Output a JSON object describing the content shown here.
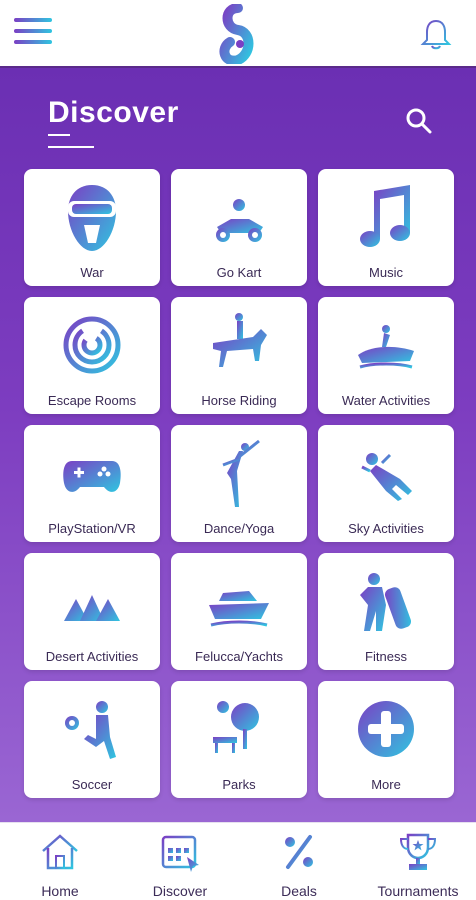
{
  "header": {
    "menu_icon": "hamburger-menu-icon",
    "logo": "app-logo",
    "notification_icon": "bell-icon"
  },
  "page": {
    "title": "Discover",
    "search_icon": "search-icon"
  },
  "categories": [
    {
      "label": "War",
      "icon": "paintball-mask-icon"
    },
    {
      "label": "Go Kart",
      "icon": "go-kart-icon"
    },
    {
      "label": "Music",
      "icon": "music-note-icon"
    },
    {
      "label": "Escape Rooms",
      "icon": "maze-icon"
    },
    {
      "label": "Horse Riding",
      "icon": "horse-rider-icon"
    },
    {
      "label": "Water Activities",
      "icon": "jet-ski-icon"
    },
    {
      "label": "PlayStation/VR",
      "icon": "gamepad-icon"
    },
    {
      "label": "Dance/Yoga",
      "icon": "dancer-icon"
    },
    {
      "label": "Sky Activities",
      "icon": "skydiver-icon"
    },
    {
      "label": "Desert Activities",
      "icon": "tents-icon"
    },
    {
      "label": "Felucca/Yachts",
      "icon": "yacht-icon"
    },
    {
      "label": "Fitness",
      "icon": "fitness-icon"
    },
    {
      "label": "Soccer",
      "icon": "soccer-player-icon"
    },
    {
      "label": "Parks",
      "icon": "park-icon"
    },
    {
      "label": "More",
      "icon": "plus-circle-icon"
    }
  ],
  "bottom_nav": [
    {
      "label": "Home",
      "icon": "home-icon"
    },
    {
      "label": "Discover",
      "icon": "calendar-grid-icon"
    },
    {
      "label": "Deals",
      "icon": "percent-icon"
    },
    {
      "label": "Tournaments",
      "icon": "trophy-icon"
    }
  ],
  "colors": {
    "primary": "#6b2fb3",
    "accent_gradient_start": "#7b3fc4",
    "accent_gradient_end": "#2fc6e0",
    "tile_background": "#ffffff"
  }
}
